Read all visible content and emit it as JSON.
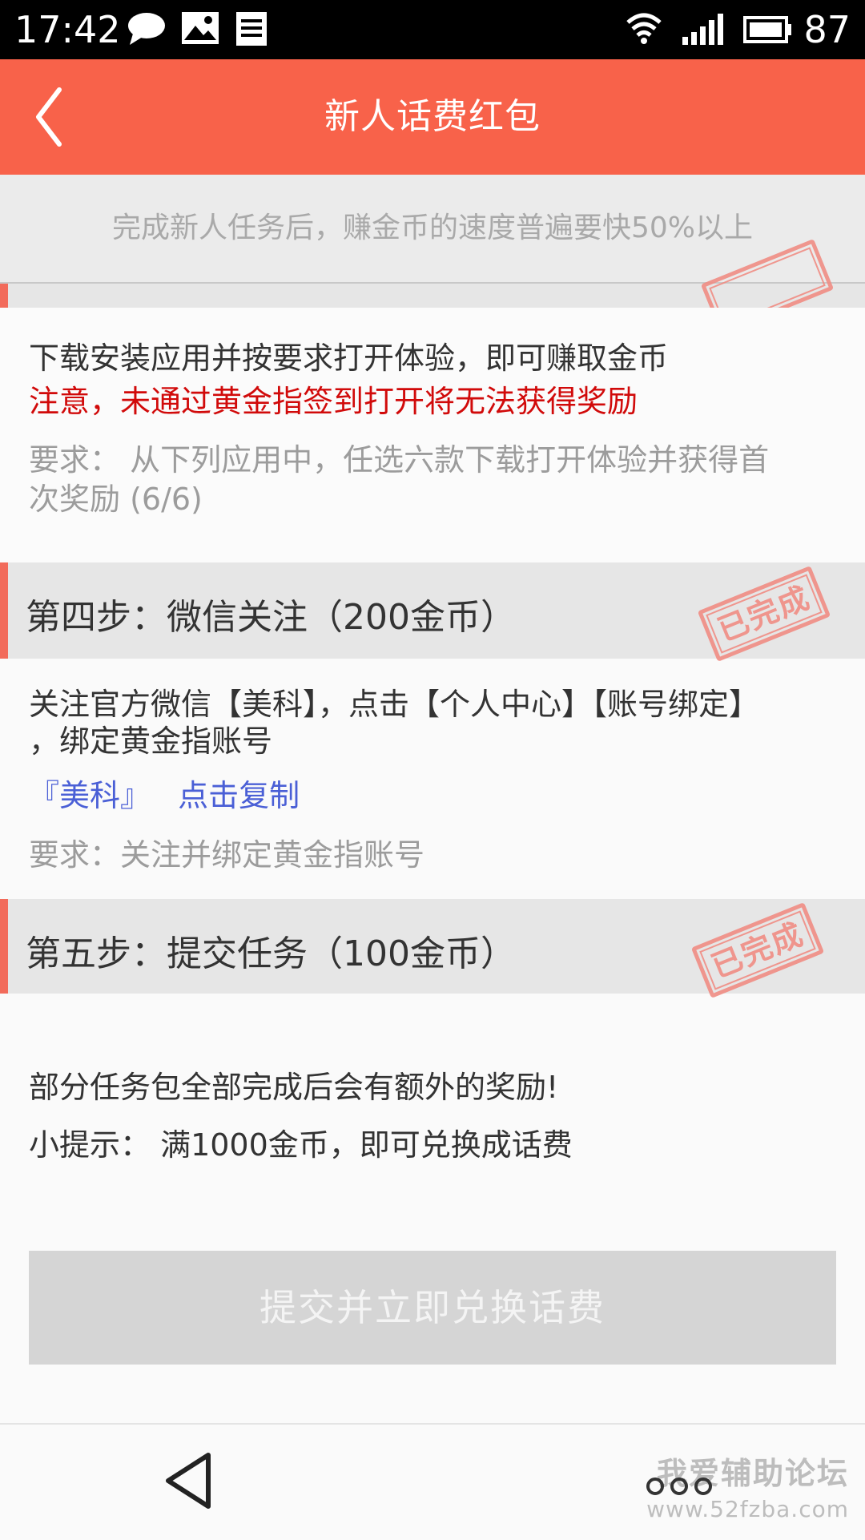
{
  "status_bar": {
    "time": "17:42",
    "battery": "87",
    "icons": [
      "message-icon",
      "image-icon",
      "notes-icon",
      "wifi-icon",
      "signal-icon",
      "battery-icon"
    ]
  },
  "header": {
    "title": "新人话费红包",
    "back_icon": "chevron-left-icon"
  },
  "notice": "完成新人任务后，赚金币的速度普遍要快50%以上",
  "step3": {
    "line1": "下载安装应用并按要求打开体验，即可赚取金币",
    "warning": "注意，未通过黄金指签到打开将无法获得奖励",
    "requirement_line1": "要求： 从下列应用中，任选六款下载打开体验并获得首",
    "requirement_line2": "次奖励 (6/6)"
  },
  "step4": {
    "title": "第四步：微信关注（200金币）",
    "stamp": "已完成",
    "desc_line1": "关注官方微信【美科】，点击【个人中心】【账号绑定】",
    "desc_line2": "，绑定黄金指账号",
    "link_name": "『美科』",
    "link_copy": "点击复制",
    "requirement": "要求：关注并绑定黄金指账号"
  },
  "step5": {
    "title": "第五步：提交任务（100金币）",
    "stamp": "已完成"
  },
  "tips": {
    "line1": "部分任务包全部完成后会有额外的奖励!",
    "line2": "小提示： 满1000金币，即可兑换成话费"
  },
  "submit_button": "提交并立即兑换话费",
  "watermark": {
    "line1": "我爱辅助论坛",
    "line2": "www.52fzba.com"
  },
  "colors": {
    "header": "#f8624a",
    "accent": "#f26b5b",
    "warning": "#d10a0a",
    "link": "#4a5fd6",
    "stamp": "#f08d84"
  }
}
